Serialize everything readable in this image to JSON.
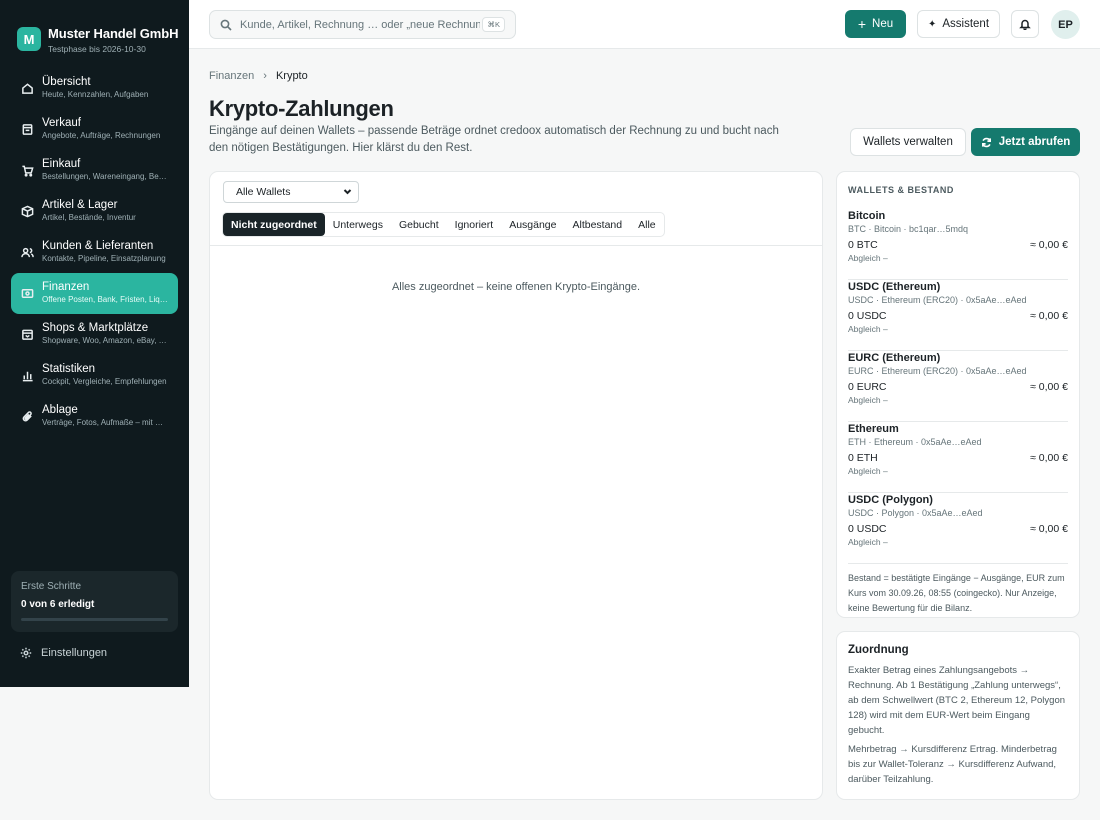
{
  "brand": {
    "logo_letter": "M",
    "name": "Muster Handel GmbH",
    "subtitle": "Testphase bis 2026-10-30"
  },
  "sidebar": {
    "items": [
      {
        "label": "Übersicht",
        "sub": "Heute, Kennzahlen, Aufgaben",
        "icon": "home-icon"
      },
      {
        "label": "Verkauf",
        "sub": "Angebote, Aufträge, Rechnungen",
        "icon": "receipt-icon"
      },
      {
        "label": "Einkauf",
        "sub": "Bestellungen, Wareneingang, Belege",
        "icon": "cart-icon"
      },
      {
        "label": "Artikel & Lager",
        "sub": "Artikel, Bestände, Inventur",
        "icon": "box-icon"
      },
      {
        "label": "Kunden & Lieferanten",
        "sub": "Kontakte, Pipeline, Einsatzplanung",
        "icon": "users-icon"
      },
      {
        "label": "Finanzen",
        "sub": "Offene Posten, Bank, Fristen, Liquidität",
        "icon": "wallet-icon",
        "active": true
      },
      {
        "label": "Shops & Marktplätze",
        "sub": "Shopware, Woo, Amazon, eBay, Etsy",
        "icon": "shop-icon"
      },
      {
        "label": "Statistiken",
        "sub": "Cockpit, Vergleiche, Empfehlungen",
        "icon": "bar-chart-icon"
      },
      {
        "label": "Ablage",
        "sub": "Verträge, Fotos, Aufmaße – mit Suche",
        "icon": "paperclip-icon"
      }
    ],
    "onboarding": {
      "title": "Erste Schritte",
      "progress": "0 von 6 erledigt",
      "progress_fraction": 0
    },
    "settings_label": "Einstellungen"
  },
  "topbar": {
    "search_placeholder": "Kunde, Artikel, Rechnung … oder „neue Rechnung“",
    "search_shortcut": "⌘K",
    "new_label": "Neu",
    "assistant_label": "Assistent",
    "avatar_initials": "EP"
  },
  "breadcrumb": {
    "parent": "Finanzen",
    "current": "Krypto"
  },
  "page": {
    "title": "Krypto-Zahlungen",
    "description": "Eingänge auf deinen Wallets – passende Beträge ordnet credoox automatisch der Rechnung zu und bucht nach den nötigen Bestätigungen. Hier klärst du den Rest.",
    "manage_wallets_label": "Wallets verwalten",
    "fetch_label": "Jetzt abrufen"
  },
  "filters": {
    "wallet_select_value": "Alle Wallets",
    "tabs": [
      "Nicht zugeordnet",
      "Unterwegs",
      "Gebucht",
      "Ignoriert",
      "Ausgänge",
      "Altbestand",
      "Alle"
    ],
    "active_tab": 0
  },
  "empty_message": "Alles zugeordnet – keine offenen Krypto-Eingänge.",
  "wallets_card": {
    "heading": "WALLETS & BESTAND",
    "wallets": [
      {
        "name": "Bitcoin",
        "meta": "BTC · Bitcoin · bc1qar…5mdq",
        "balance": "0 BTC",
        "eur": "≈ 0,00 €",
        "sync": "Abgleich –"
      },
      {
        "name": "USDC (Ethereum)",
        "meta": "USDC · Ethereum (ERC20) · 0x5aAe…eAed",
        "balance": "0 USDC",
        "eur": "≈ 0,00 €",
        "sync": "Abgleich –"
      },
      {
        "name": "EURC (Ethereum)",
        "meta": "EURC · Ethereum (ERC20) · 0x5aAe…eAed",
        "balance": "0 EURC",
        "eur": "≈ 0,00 €",
        "sync": "Abgleich –"
      },
      {
        "name": "Ethereum",
        "meta": "ETH · Ethereum · 0x5aAe…eAed",
        "balance": "0 ETH",
        "eur": "≈ 0,00 €",
        "sync": "Abgleich –"
      },
      {
        "name": "USDC (Polygon)",
        "meta": "USDC · Polygon · 0x5aAe…eAed",
        "balance": "0 USDC",
        "eur": "≈ 0,00 €",
        "sync": "Abgleich –"
      }
    ],
    "note": "Bestand = bestätigte Eingänge − Ausgänge, EUR zum Kurs vom 30.09.26, 08:55 (coingecko). Nur Anzeige, keine Bewertung für die Bilanz."
  },
  "assignment_card": {
    "title": "Zuordnung",
    "p1": "Exakter Betrag eines Zahlungsangebots → Rechnung. Ab 1 Bestätigung „Zahlung unterwegs“, ab dem Schwellwert (BTC 2, Ethereum 12, Polygon 128) wird mit dem EUR-Wert beim Eingang gebucht.",
    "p2": "Mehrbetrag → Kursdifferenz Ertrag. Minderbetrag bis zur Wallet-Toleranz → Kursdifferenz Aufwand, darüber Teilzahlung."
  },
  "colors": {
    "accent": "#2bb5a0",
    "primary_button": "#157a6e",
    "sidebar_bg": "#0f1a1e"
  }
}
